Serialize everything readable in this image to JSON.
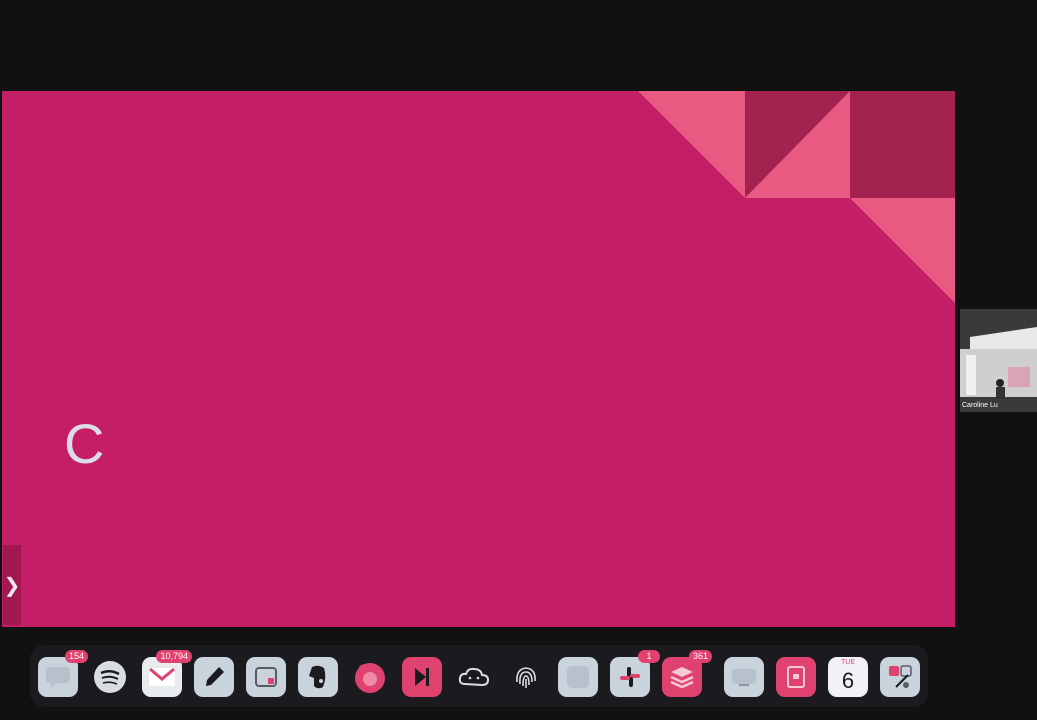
{
  "slide": {
    "letter": "C",
    "background": "#c41e66",
    "accent_light": "#e85a82",
    "accent_dark": "#a0184f",
    "sidebar_toggle": "❯"
  },
  "participant": {
    "name": "Caroline Lu"
  },
  "dock": {
    "items": [
      {
        "name": "messages-icon",
        "badge": "154"
      },
      {
        "name": "spotify-icon",
        "badge": ""
      },
      {
        "name": "gmail-icon",
        "badge": "10,794"
      },
      {
        "name": "pencil-app-icon",
        "badge": ""
      },
      {
        "name": "window-app-icon",
        "badge": ""
      },
      {
        "name": "evernote-icon",
        "badge": ""
      },
      {
        "name": "firefox-icon",
        "badge": ""
      },
      {
        "name": "media-player-icon",
        "badge": ""
      },
      {
        "name": "cloud-app-icon",
        "badge": ""
      },
      {
        "name": "fingerprint-icon",
        "badge": ""
      },
      {
        "name": "blank-app-icon",
        "badge": ""
      },
      {
        "name": "slack-icon",
        "badge": "1"
      },
      {
        "name": "todoist-icon",
        "badge": "361"
      },
      {
        "name": "screen-app-icon",
        "badge": ""
      },
      {
        "name": "document-app-icon",
        "badge": ""
      },
      {
        "name": "calendar-icon",
        "badge": "",
        "day": "TUE",
        "date": "6"
      },
      {
        "name": "tools-app-icon",
        "badge": ""
      }
    ]
  }
}
